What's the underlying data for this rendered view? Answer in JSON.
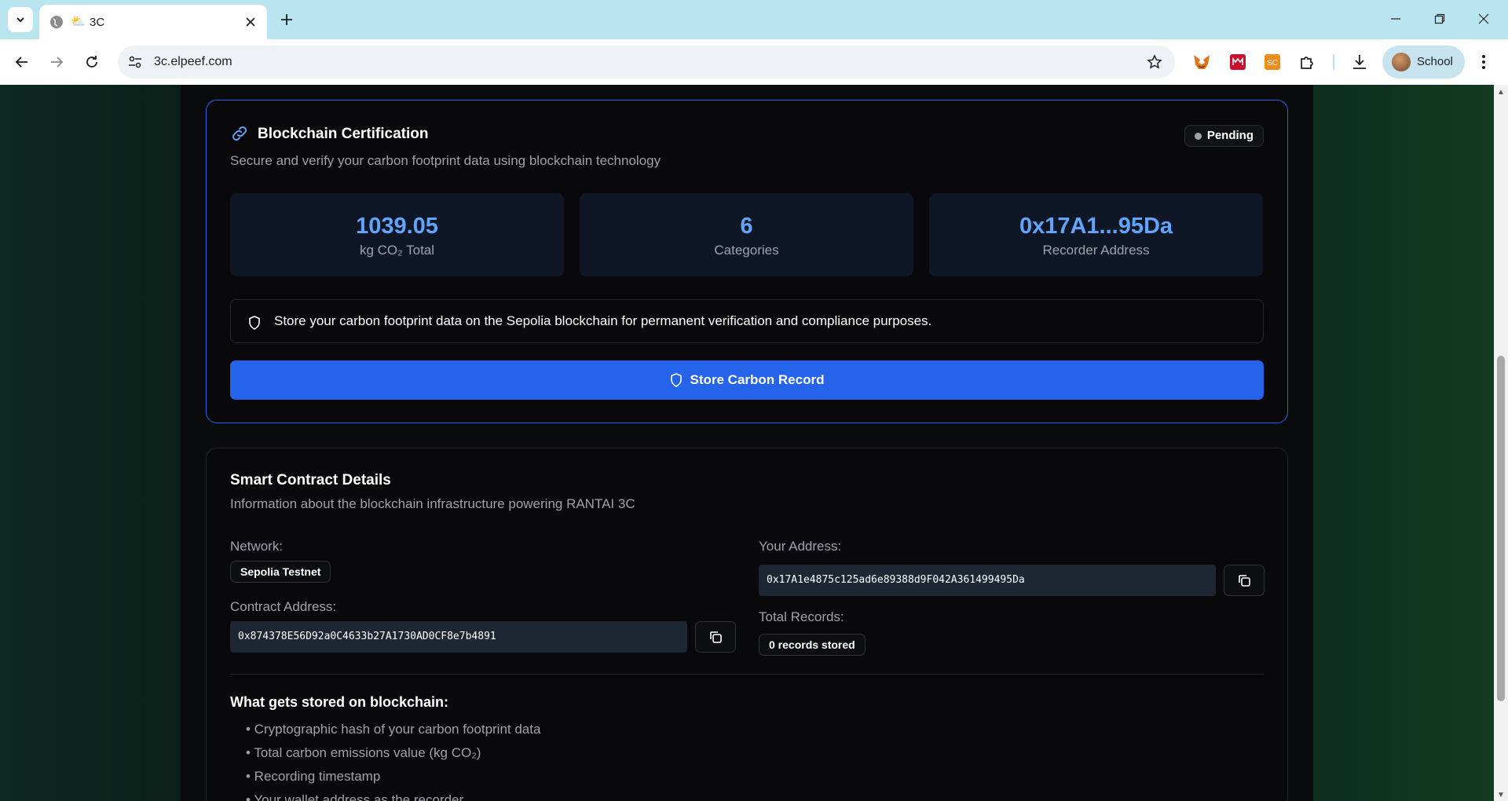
{
  "browser": {
    "tab_title": "3C",
    "url": "3c.elpeef.com",
    "profile_name": "School",
    "extensions": [
      "metamask-icon",
      "red-extension-icon",
      "3c-extension-icon",
      "puzzle-icon"
    ]
  },
  "certification": {
    "title": "Blockchain Certification",
    "subtitle": "Secure and verify your carbon footprint data using blockchain technology",
    "status": "Pending",
    "stats": [
      {
        "value": "1039.05",
        "label": "kg CO₂ Total"
      },
      {
        "value": "6",
        "label": "Categories"
      },
      {
        "value": "0x17A1...95Da",
        "label": "Recorder Address"
      }
    ],
    "info_text": "Store your carbon footprint data on the Sepolia blockchain for permanent verification and compliance purposes.",
    "store_button": "Store Carbon Record",
    "accent": "#2563eb",
    "value_color": "#60a5fa"
  },
  "contract": {
    "title": "Smart Contract Details",
    "subtitle": "Information about the blockchain infrastructure powering RANTAI 3C",
    "network_label": "Network:",
    "network_value": "Sepolia Testnet",
    "contract_label": "Contract Address:",
    "contract_address": "0x874378E56D92a0C4633b27A1730AD0CF8e7b4891",
    "your_address_label": "Your Address:",
    "your_address": "0x17A1e4875c125ad6e89388d9F042A361499495Da",
    "total_records_label": "Total Records:",
    "total_records_value": "0 records stored",
    "stored_heading": "What gets stored on blockchain:",
    "stored_items": [
      "• Cryptographic hash of your carbon footprint data",
      "• Total carbon emissions value (kg CO₂)",
      "• Recording timestamp",
      "• Your wallet address as the recorder"
    ]
  }
}
